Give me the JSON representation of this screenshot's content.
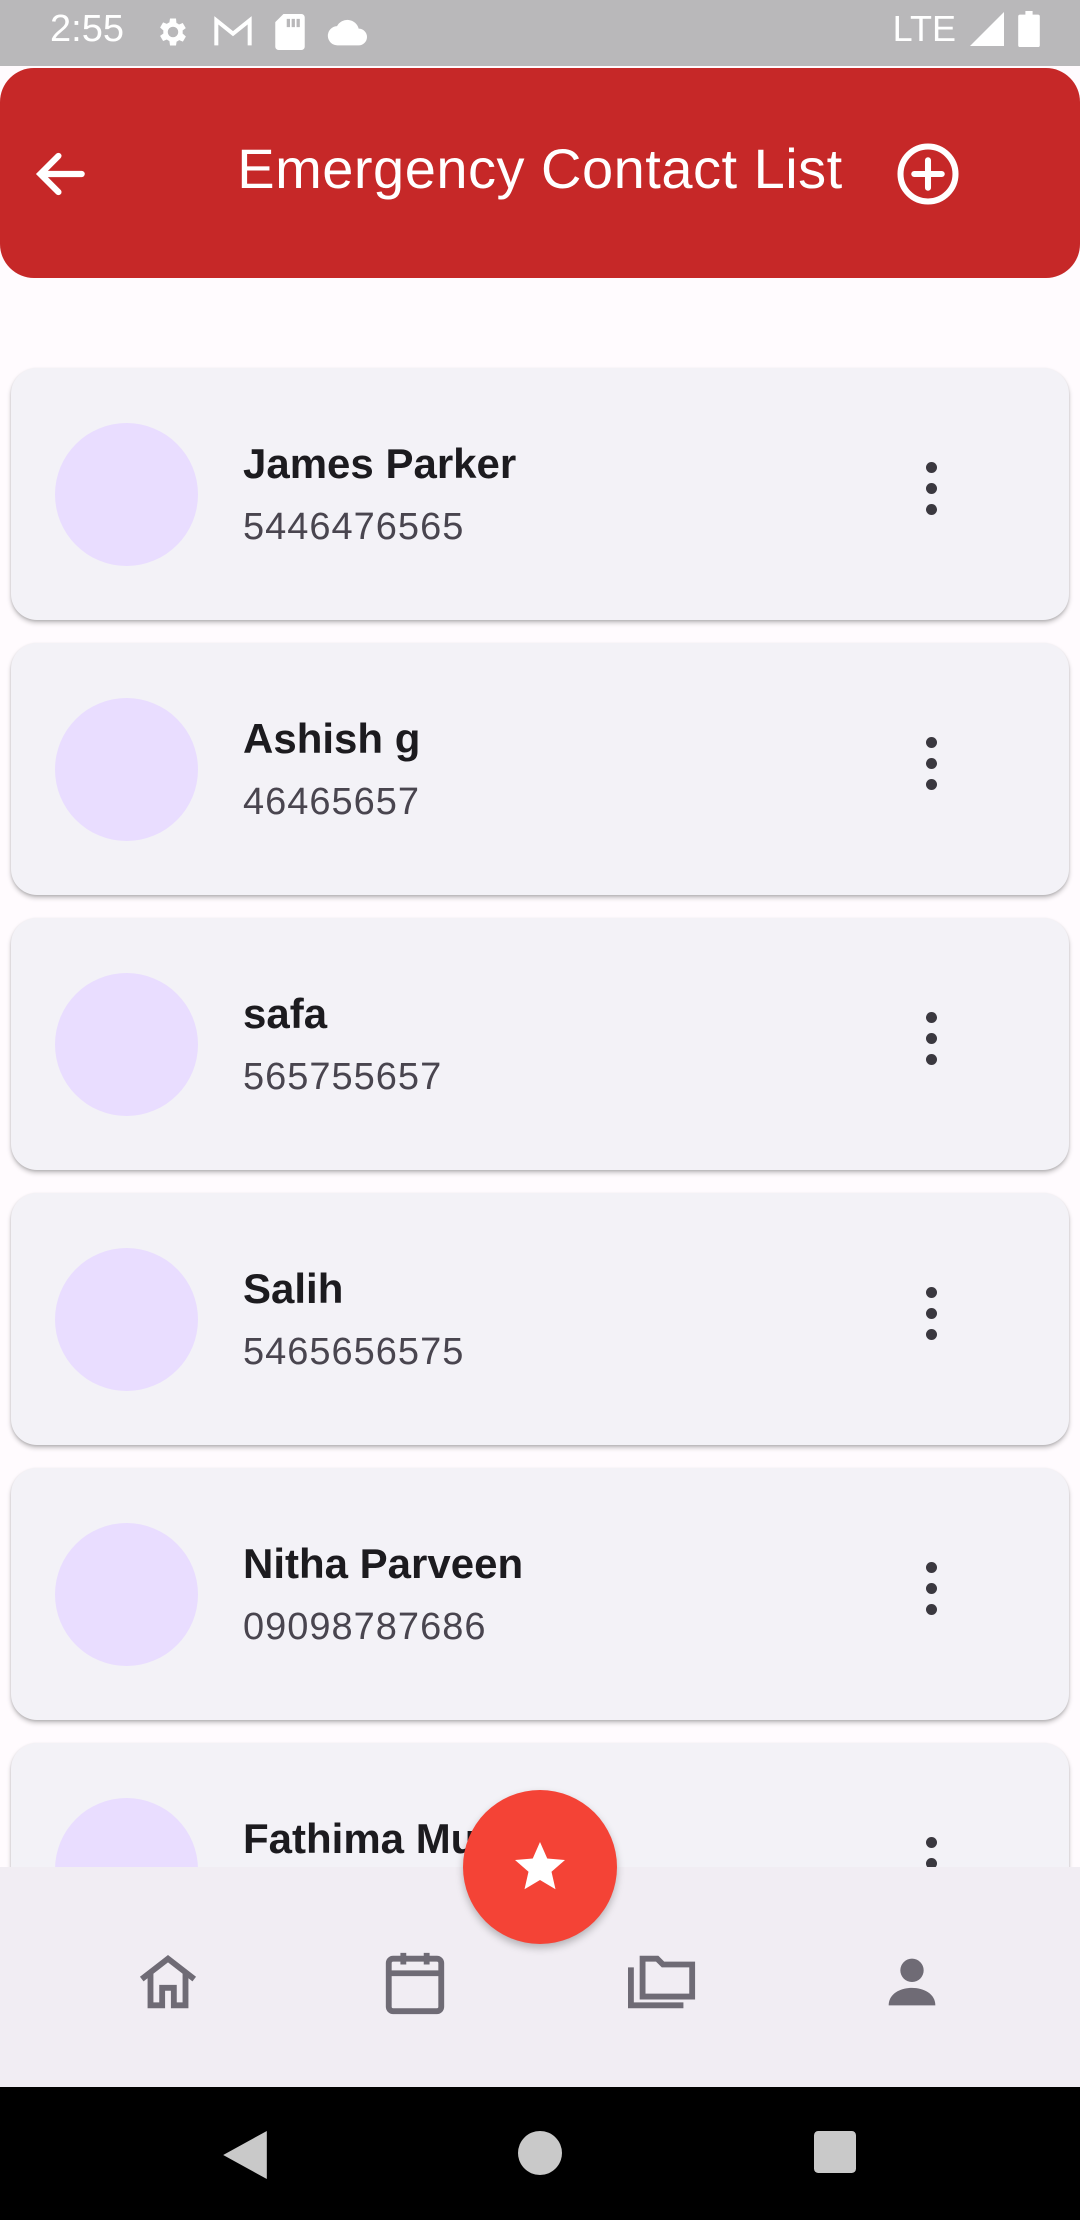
{
  "status_bar": {
    "time": "2:55",
    "network": "LTE",
    "icons": [
      "settings-icon",
      "gmail-icon",
      "sd-card-icon",
      "cloud-icon",
      "signal-icon",
      "battery-icon"
    ]
  },
  "app_bar": {
    "title": "Emergency Contact List",
    "back_icon": "arrow-back-icon",
    "add_icon": "add-circle-icon",
    "color": "#c62828"
  },
  "contacts": [
    {
      "name": "James Parker",
      "phone": "5446476565"
    },
    {
      "name": "Ashish g",
      "phone": "46465657"
    },
    {
      "name": "safa",
      "phone": "565755657"
    },
    {
      "name": "Salih",
      "phone": "5465656575"
    },
    {
      "name": "Nitha Parveen",
      "phone": "09098787686"
    },
    {
      "name": "Fathima Mu…ra",
      "phone": ""
    }
  ],
  "fab": {
    "icon": "star-icon",
    "color": "#f44336"
  },
  "bottom_nav": {
    "items": [
      "home-icon",
      "calendar-icon",
      "folders-icon",
      "person-icon"
    ]
  },
  "system_nav": [
    "back-icon",
    "home-circle-icon",
    "recents-icon"
  ]
}
